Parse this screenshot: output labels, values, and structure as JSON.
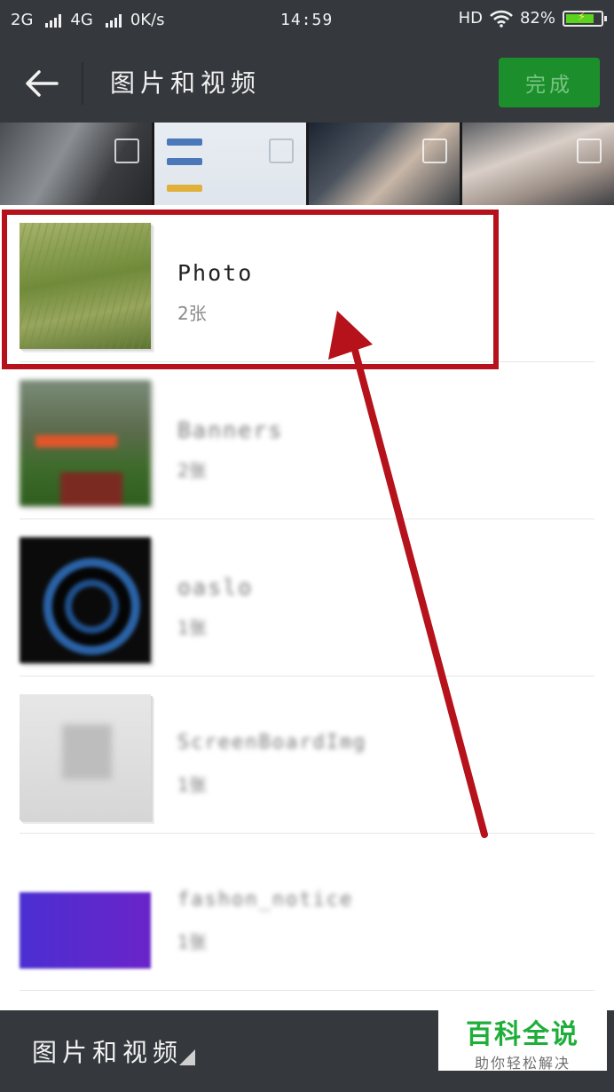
{
  "status_bar": {
    "network1": "2G",
    "network2": "4G",
    "speed": "0K/s",
    "time": "14:59",
    "hd": "HD",
    "battery_percent": "82%",
    "battery_level": 0.82
  },
  "header": {
    "title": "图片和视频",
    "done_label": "完成",
    "accent_color": "#1c8f2c"
  },
  "albums": [
    {
      "name": "Photo",
      "count": "2张"
    },
    {
      "name": "Banners",
      "count": "2张"
    },
    {
      "name": "oaslo",
      "count": "1张"
    },
    {
      "name": "ScreenBoardImg",
      "count": "1张"
    },
    {
      "name": "fashon_notice",
      "count": "1张"
    }
  ],
  "footer": {
    "album_picker_label": "图片和视频"
  },
  "watermark": {
    "main": "百科全说",
    "sub": "助你轻松解决"
  },
  "annotation_color": "#b5121b"
}
